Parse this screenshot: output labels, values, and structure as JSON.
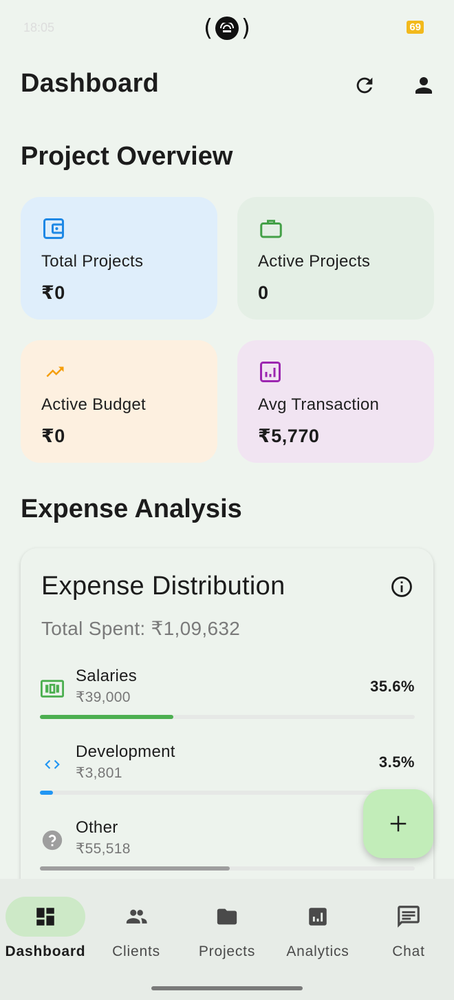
{
  "status_bar": {
    "time": "18:05",
    "battery": "69"
  },
  "header": {
    "title": "Dashboard",
    "refresh_icon": "refresh-icon",
    "profile_icon": "person-icon"
  },
  "overview": {
    "title": "Project Overview",
    "cards": [
      {
        "label": "Total Projects",
        "value": "₹0",
        "icon": "wallet-icon",
        "color": "#1e88e5",
        "bg": "#dfeefb"
      },
      {
        "label": "Active Projects",
        "value": "0",
        "icon": "briefcase-icon",
        "color": "#43a047",
        "bg": "#e4efe5"
      },
      {
        "label": "Active Budget",
        "value": "₹0",
        "icon": "trending-up-icon",
        "color": "#f59e0b",
        "bg": "#fdf0e0"
      },
      {
        "label": "Avg Transaction",
        "value": "₹5,770",
        "icon": "analytics-icon",
        "color": "#9c27b0",
        "bg": "#f1e4f2"
      }
    ]
  },
  "expense": {
    "section_title": "Expense Analysis",
    "card_title": "Expense Distribution",
    "total_spent": "Total Spent: ₹1,09,632",
    "items": [
      {
        "name": "Salaries",
        "amount": "₹39,000",
        "percent": "35.6%",
        "fraction": 0.356,
        "color": "#4caf50",
        "icon": "money-icon"
      },
      {
        "name": "Development",
        "amount": "₹3,801",
        "percent": "3.5%",
        "fraction": 0.035,
        "color": "#2196f3",
        "icon": "code-icon"
      },
      {
        "name": "Other",
        "amount": "₹55,518",
        "percent": "50.6%",
        "fraction": 0.506,
        "color": "#9e9e9e",
        "icon": "help-icon"
      }
    ]
  },
  "fab": {
    "icon": "plus-icon"
  },
  "nav": {
    "items": [
      {
        "label": "Dashboard",
        "icon": "dashboard-icon",
        "active": true
      },
      {
        "label": "Clients",
        "icon": "people-icon",
        "active": false
      },
      {
        "label": "Projects",
        "icon": "folder-icon",
        "active": false
      },
      {
        "label": "Analytics",
        "icon": "analytics-icon",
        "active": false
      },
      {
        "label": "Chat",
        "icon": "chat-icon",
        "active": false
      }
    ]
  }
}
